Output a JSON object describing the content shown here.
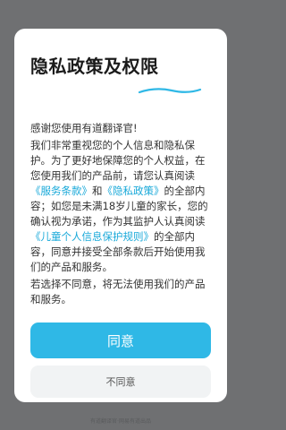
{
  "dialog": {
    "title": "隐私政策及权限",
    "greeting": "感谢您使用有道翻译官!",
    "para1_a": "我们非常重视您的个人信息和隐私保护。为了更好地保障您的个人权益，在您使用我们的产品前，请您认真阅读",
    "link_terms": "《服务条款》",
    "para1_b": "和",
    "link_privacy": "《隐私政策》",
    "para1_c": "的全部内容；如您是未满18岁儿童的家长，您的确认视为承诺，作为其监护人认真阅读",
    "link_children": "《儿童个人信息保护规则》",
    "para1_d": "的全部内容，同意并接受全部条款后开始使用我们的产品和服务。",
    "para2": "若选择不同意，将无法使用我们的产品和服务。",
    "agree_label": "同意",
    "decline_label": "不同意"
  },
  "backdrop": {
    "footer_text": "有道翻译官·网易有道出品"
  },
  "colors": {
    "accent": "#2fb8e6",
    "link": "#19a9d9"
  }
}
